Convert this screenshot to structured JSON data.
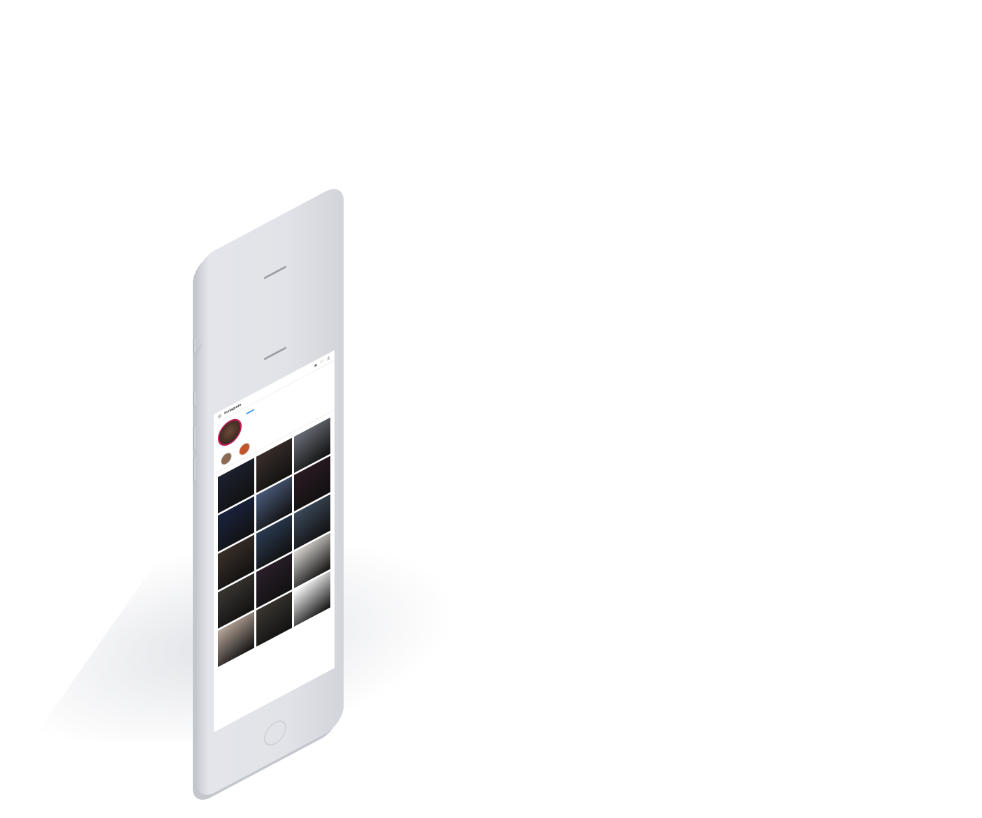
{
  "app": {
    "logo_text": "Instagram"
  },
  "profile": {
    "username": "",
    "follow_label": "",
    "stats": [
      "",
      "",
      ""
    ],
    "bio_lines": [
      "",
      "",
      "",
      ""
    ],
    "link": ""
  },
  "highlights": [
    {
      "label": ""
    },
    {
      "label": ""
    }
  ],
  "tabs": [
    "",
    "",
    ""
  ],
  "tiles": [
    "#1d2130",
    "#3a2e2a",
    "#6b6e78",
    "#1a2440",
    "#4a5a7a",
    "#2a1a22",
    "#3a2f28",
    "#2b3b52",
    "#3c4a5a",
    "#3a3632",
    "#2a1e2a",
    "#d8d4d0",
    "#b8a69a",
    "#3a3630",
    "#ffffff"
  ],
  "post_caption": ""
}
